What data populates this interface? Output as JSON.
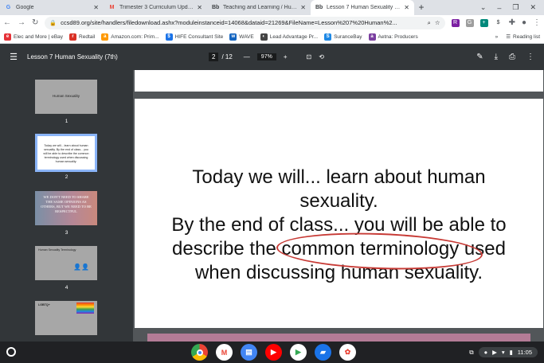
{
  "tabs": [
    {
      "icon": "G",
      "title": "Google",
      "color": "#4285f4"
    },
    {
      "icon": "M",
      "title": "Trimester 3 Curriculum Update:",
      "color": "#ea4335"
    },
    {
      "icon": "Bb",
      "title": "Teaching and Learning / Human",
      "color": "#222222"
    },
    {
      "icon": "Bb",
      "title": "Lesson 7 Human Sexuality (7th)",
      "color": "#222222"
    }
  ],
  "address_bar": {
    "url": "ccsd89.org/site/handlers/filedownload.ashx?moduleinstanceid=14068&dataid=21269&FileName=Lesson%207%20Human%2..."
  },
  "bookmarks": [
    {
      "label": "Elec and More | eBay",
      "color": "#e53238"
    },
    {
      "label": "Redtail",
      "color": "#d93025"
    },
    {
      "label": "Amazon.com: Prim...",
      "color": "#ff9900"
    },
    {
      "label": "HIFE Consultant Site",
      "color": "#1a73e8"
    },
    {
      "label": "WAVE",
      "color": "#1565c0"
    },
    {
      "label": "Lead Advantage Pr...",
      "color": "#444444"
    },
    {
      "label": "SuranceBay",
      "color": "#1e88e5"
    },
    {
      "label": "Aetna: Producers",
      "color": "#7b3fa0"
    }
  ],
  "bookmarks_more": "»",
  "reading_list": "Reading list",
  "pdf": {
    "title": "Lesson 7 Human Sexuality (7th)",
    "page_current": "2",
    "page_total": "/ 12",
    "zoom": "97%"
  },
  "thumbnails": [
    {
      "num": "1",
      "text": "Human Sexuality"
    },
    {
      "num": "2",
      "text": "Today we will... learn about human sexuality. By the end of class... you will be able to describe the common terminology used when discussing human sexuality."
    },
    {
      "num": "3",
      "text": "WE DON'T NEED TO SHARE THE SAME OPINIONS AS OTHERS, BUT WE NEED TO BE RESPECTFUL"
    },
    {
      "num": "4",
      "text": "Human Sexuality Terminology"
    },
    {
      "num": "5",
      "text": "LGBTQ+"
    }
  ],
  "slide": {
    "line1": "Today we will... learn about human",
    "line2": "sexuality.",
    "line3": "By the end of class... you will be able to",
    "line4_pre": "describe the ",
    "line4_circled": "common terminology",
    "line4_post": " used",
    "line5": "when discussing human sexuality."
  },
  "shelf": {
    "time": "11:05"
  }
}
